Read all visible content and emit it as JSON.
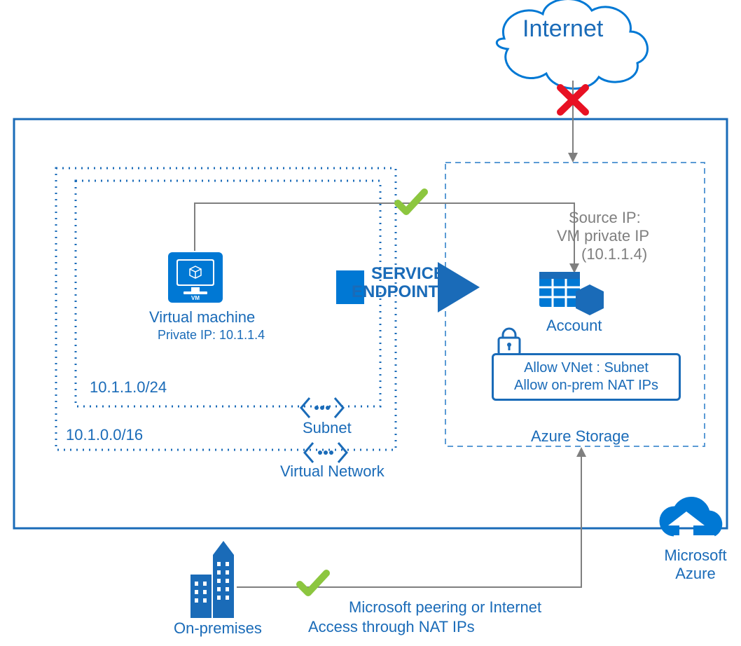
{
  "internet_label": "Internet",
  "azure_region_label": "Microsoft Azure",
  "vnet": {
    "label": "Virtual Network",
    "cidr": "10.1.0.0/16",
    "subnet": {
      "label": "Subnet",
      "cidr": "10.1.1.0/24",
      "vm": {
        "title": "Virtual machine",
        "private_ip_label": "Private IP: 10.1.1.4"
      }
    }
  },
  "service_endpoint_label_1": "SERVICE",
  "service_endpoint_label_2": "ENDPOINT",
  "storage": {
    "region_label": "Azure Storage",
    "account_label": "Account",
    "rule_1": "Allow VNet : Subnet",
    "rule_2": "Allow on-prem NAT IPs",
    "incoming_source_1": "Source IP:",
    "incoming_source_2": "VM private IP",
    "incoming_source_3": "(10.1.1.4)"
  },
  "onprem": {
    "label": "On-premises",
    "path_label_1": "Microsoft peering or Internet",
    "path_label_2": "Access through NAT IPs"
  },
  "colors": {
    "azure_blue": "#1a6bb8",
    "accent_blue": "#0078d4",
    "ok_green": "#8cc63f",
    "deny_red": "#e81123",
    "frame_gray": "#7f7f7f",
    "dash_blue": "#5b9bd5"
  }
}
